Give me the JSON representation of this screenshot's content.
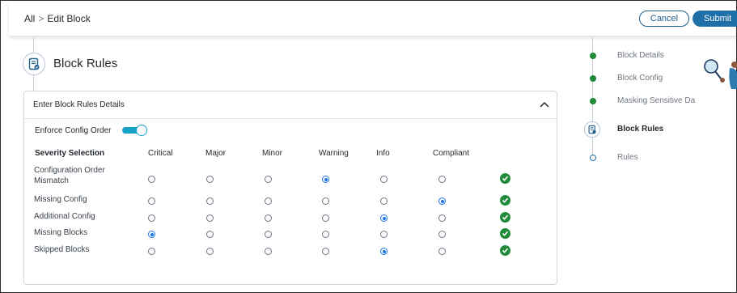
{
  "header": {
    "breadcrumb_root": "All",
    "breadcrumb_sep": ">",
    "breadcrumb_current": "Edit Block",
    "cancel_label": "Cancel",
    "submit_label": "Submit"
  },
  "section": {
    "title": "Block Rules",
    "icon": "document-check-icon"
  },
  "panel": {
    "title": "Enter Block Rules Details",
    "toggle_label": "Enforce Config Order",
    "toggle_on": true,
    "columns": [
      "Severity Selection",
      "Critical",
      "Major",
      "Minor",
      "Warning",
      "Info",
      "Compliant"
    ],
    "rows": [
      {
        "label": "Configuration Order Mismatch",
        "selected": "Warning"
      },
      {
        "label": "Missing Config",
        "selected": "Compliant"
      },
      {
        "label": "Additional Config",
        "selected": "Info"
      },
      {
        "label": "Missing Blocks",
        "selected": "Critical"
      },
      {
        "label": "Skipped Blocks",
        "selected": "Info"
      }
    ]
  },
  "stepper": {
    "steps": [
      {
        "label": "Block Details",
        "state": "done"
      },
      {
        "label": "Block Config",
        "state": "done"
      },
      {
        "label": "Masking Sensitive Da",
        "state": "done"
      },
      {
        "label": "Block Rules",
        "state": "active"
      },
      {
        "label": "Rules",
        "state": "pending"
      }
    ]
  },
  "colors": {
    "accent": "#1e6fa8",
    "toggle": "#17a2c9",
    "done": "#1f8a3a",
    "radio_selected": "#1a73e8"
  }
}
